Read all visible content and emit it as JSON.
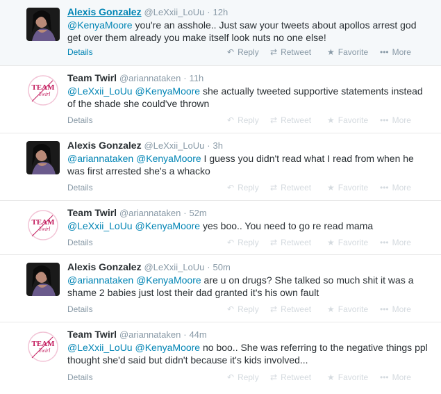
{
  "tweets": [
    {
      "name": "Alexis Gonzalez",
      "handle": "@LeXxii_LoUu",
      "time": "12h",
      "mentions": [
        "@KenyaMoore"
      ],
      "text": " you're an asshole.. Just saw your tweets about apollos arrest god get over them already you make itself look nuts no one else!",
      "avatar": "alexis"
    },
    {
      "name": "Team Twirl",
      "handle": "@ariannataken",
      "time": "11h",
      "mentions": [
        "@LeXxii_LoUu",
        "@KenyaMoore"
      ],
      "text": " she actually tweeted supportive statements instead of the shade she could've thrown",
      "avatar": "teamtwirl"
    },
    {
      "name": "Alexis Gonzalez",
      "handle": "@LeXxii_LoUu",
      "time": "3h",
      "mentions": [
        "@ariannataken",
        "@KenyaMoore"
      ],
      "text": " I guess you didn't read what I read from when he was first arrested she's a whacko",
      "avatar": "alexis"
    },
    {
      "name": "Team Twirl",
      "handle": "@ariannataken",
      "time": "52m",
      "mentions": [
        "@LeXxii_LoUu",
        "@KenyaMoore"
      ],
      "text": " yes boo.. You need to go re read mama",
      "avatar": "teamtwirl"
    },
    {
      "name": "Alexis Gonzalez",
      "handle": "@LeXxii_LoUu",
      "time": "50m",
      "mentions": [
        "@ariannataken",
        "@KenyaMoore"
      ],
      "text": " are u on drugs? She talked so much shit it was a shame 2 babies just lost their dad granted it's his own fault",
      "avatar": "alexis"
    },
    {
      "name": "Team Twirl",
      "handle": "@ariannataken",
      "time": "44m",
      "mentions": [
        "@LeXxii_LoUu",
        "@KenyaMoore"
      ],
      "text": " no boo.. She was referring to the negative things ppl thought she'd said but didn't  because it's kids involved...",
      "avatar": "teamtwirl"
    }
  ],
  "labels": {
    "details": "Details",
    "reply": "Reply",
    "retweet": "Retweet",
    "favorite": "Favorite",
    "more": "More",
    "dot": "·",
    "team_logo_line1": "TEAM",
    "team_logo_line2": "Twirl"
  },
  "icons": {
    "reply": "reply-icon",
    "retweet": "retweet-icon",
    "favorite": "star-icon",
    "more": "ellipsis-icon"
  },
  "colors": {
    "link": "#0084b4",
    "text": "#292f33",
    "muted": "#8899a6",
    "team_logo": "#c2185b"
  }
}
